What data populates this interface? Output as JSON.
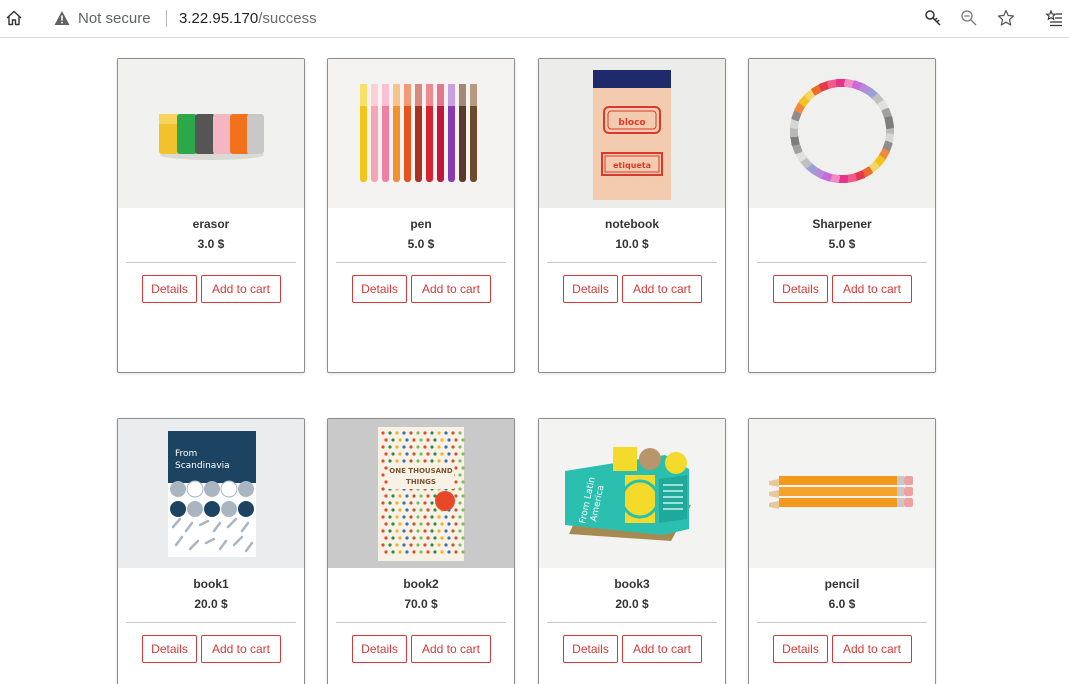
{
  "browser": {
    "security_label": "Not secure",
    "url_host": "3.22.95.170",
    "url_path": "/success"
  },
  "buttons": {
    "details": "Details",
    "add_to_cart": "Add to cart"
  },
  "products": [
    {
      "name": "erasor",
      "price": "3.0 $"
    },
    {
      "name": "pen",
      "price": "5.0 $"
    },
    {
      "name": "notebook",
      "price": "10.0 $",
      "label_top": "bloco",
      "label_bottom": "etiqueta"
    },
    {
      "name": "Sharpener",
      "price": "5.0 $"
    },
    {
      "name": "book1",
      "price": "20.0 $",
      "cover_text_1": "From",
      "cover_text_2": "Scandinavia"
    },
    {
      "name": "book2",
      "price": "70.0 $",
      "cover_text_1": "ONE THOUSAND",
      "cover_text_2": "THINGS"
    },
    {
      "name": "book3",
      "price": "20.0 $",
      "cover_text_1": "From Latin",
      "cover_text_2": "America"
    },
    {
      "name": "pencil",
      "price": "6.0 $"
    }
  ]
}
